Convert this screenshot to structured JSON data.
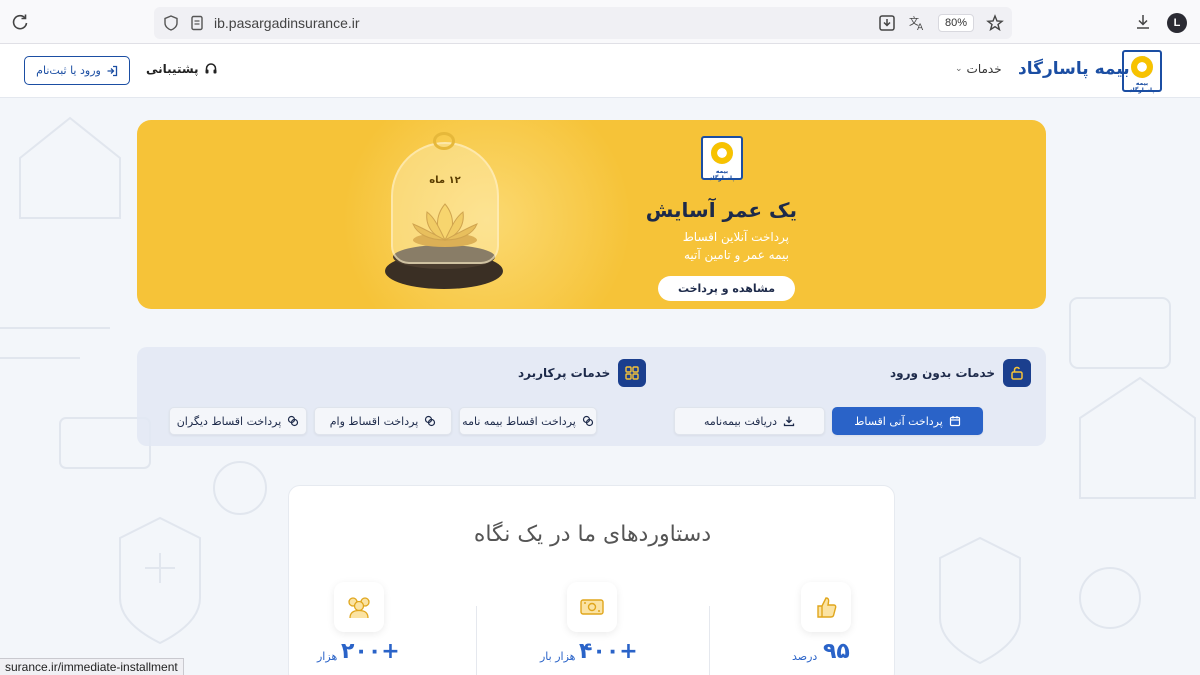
{
  "browser": {
    "url": "ib.pasargadinsurance.ir",
    "zoom": "80%",
    "profile_initial": "L",
    "status_url": "surance.ir/immediate-installment"
  },
  "header": {
    "brand_name": "بیمه پاسارگاد",
    "logo_caption": "بیمه پاسارگاد",
    "nav_services": "خدمات",
    "support_label": "پشتیبانی",
    "login_label": "ورود یا ثبت‌نام"
  },
  "banner": {
    "logo_caption": "بیمه پاسارگاد",
    "jar_label": "۱۲ ماه",
    "title": "یک عمر آسایش",
    "subtitle_line1": "پرداخت آنلاین اقساط",
    "subtitle_line2": "بیمه عمر و تامین آتیه",
    "cta_label": "مشاهده و پرداخت"
  },
  "services": {
    "no_login_title": "خدمات بدون ورود",
    "popular_title": "خدمات پرکاربرد",
    "buttons": {
      "instant_installment": "پرداخت آنی اقساط",
      "get_policy": "دریافت بیمه‌نامه",
      "policy_installments": "پرداخت اقساط بیمه نامه",
      "loan_installments": "پرداخت اقساط وام",
      "others_installments": "پرداخت اقساط دیگران"
    }
  },
  "achievements": {
    "title": "دستاوردهای ما در یک نگاه",
    "stats": [
      {
        "number": "۹۵",
        "unit": "درصد",
        "icon": "thumbs-up-icon"
      },
      {
        "number": "+۴۰۰",
        "unit": "هزار بار",
        "icon": "money-icon"
      },
      {
        "number": "+۲۰۰",
        "unit": "هزار",
        "icon": "people-icon"
      }
    ]
  },
  "colors": {
    "brand_blue": "#1b4ea3",
    "banner_yellow": "#f6c338",
    "primary_button": "#2a63c8"
  }
}
